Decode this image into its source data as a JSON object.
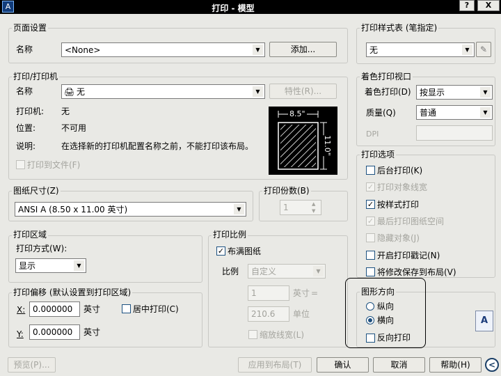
{
  "title_bar": {
    "title": "打印 - 模型",
    "help_btn": "?",
    "close_btn": "X"
  },
  "page_setup": {
    "group": "页面设置",
    "name_label": "名称",
    "name_value": "<None>",
    "add_button": "添加..."
  },
  "printer": {
    "group": "打印/打印机",
    "name_label": "名称",
    "name_value": "无",
    "properties_button": "特性(R)...",
    "printer_label": "打印机:",
    "printer_value": "无",
    "location_label": "位置:",
    "location_value": "不可用",
    "desc_label": "说明:",
    "desc_value": "在选择新的打印机配置名称之前，不能打印该布局。",
    "print_to_file": "打印到文件(F)",
    "preview_width": "8.5\"",
    "preview_height": "11.0\""
  },
  "paper_size": {
    "group": "图纸尺寸(Z)",
    "value": "ANSI A (8.50 x 11.00 英寸)"
  },
  "copies": {
    "group": "打印份数(B)",
    "value": "1"
  },
  "plot_area": {
    "group": "打印区域",
    "what_label": "打印方式(W):",
    "what_value": "显示"
  },
  "plot_offset": {
    "group": "打印偏移 (默认设置到打印区域)",
    "x_label": "X:",
    "x_value": "0.000000",
    "x_unit": "英寸",
    "y_label": "Y:",
    "y_value": "0.000000",
    "y_unit": "英寸",
    "center": "居中打印(C)"
  },
  "plot_scale": {
    "group": "打印比例",
    "fit": "布满图纸",
    "scale_label": "比例",
    "scale_value": "自定义",
    "num_value": "1",
    "num_unit": "英寸",
    "equals": "=",
    "den_value": "210.6",
    "den_unit": "单位",
    "lineweights": "缩放线宽(L)"
  },
  "plot_style": {
    "group": "打印样式表 (笔指定)",
    "value": "无"
  },
  "shaded": {
    "group": "着色打印视口",
    "shade_label": "着色打印(D)",
    "shade_value": "按显示",
    "quality_label": "质量(Q)",
    "quality_value": "普通",
    "dpi_label": "DPI"
  },
  "plot_options": {
    "group": "打印选项",
    "items": [
      {
        "label": "后台打印(K)",
        "checked": false,
        "enabled": true
      },
      {
        "label": "打印对象线宽",
        "checked": true,
        "enabled": false
      },
      {
        "label": "按样式打印",
        "checked": true,
        "enabled": true
      },
      {
        "label": "最后打印图纸空间",
        "checked": true,
        "enabled": false
      },
      {
        "label": "隐藏对象(J)",
        "checked": false,
        "enabled": false
      },
      {
        "label": "开启打印戳记(N)",
        "checked": false,
        "enabled": true
      },
      {
        "label": "将修改保存到布局(V)",
        "checked": false,
        "enabled": true
      }
    ]
  },
  "orientation": {
    "group": "图形方向",
    "portrait": "纵向",
    "landscape": "横向",
    "selected": "landscape",
    "upside_down": "反向打印",
    "icon_letter": "A"
  },
  "buttons": {
    "preview": "预览(P)...",
    "apply": "应用到布局(T)",
    "ok": "确认",
    "cancel": "取消",
    "help": "帮助(H)",
    "expand": "<"
  }
}
